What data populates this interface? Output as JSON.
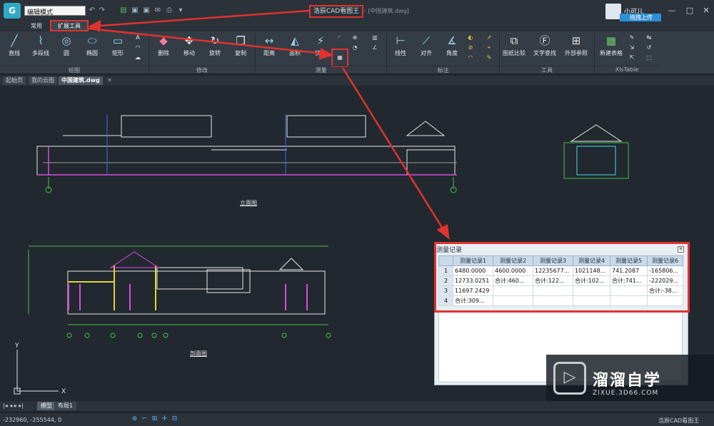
{
  "app": {
    "mode_select": "编辑模式",
    "title_main": "浩辰CAD看图王",
    "title_file": "- [中国建筑.dwg]",
    "user": "小可儿",
    "upload_btn": "拖拽上传",
    "accent_red": "#e0332e",
    "accent_blue": "#2e8fd8"
  },
  "ribbon_tabs": [
    "常用",
    "扩展工具"
  ],
  "ribbon": {
    "draw_items": [
      {
        "label": "直线",
        "icon": "line-icon"
      },
      {
        "label": "多段线",
        "icon": "polyline-icon"
      },
      {
        "label": "圆",
        "icon": "circle-icon"
      },
      {
        "label": "椭圆",
        "icon": "ellipse-icon"
      },
      {
        "label": "矩形",
        "icon": "rectangle-icon"
      }
    ],
    "edit_items": [
      {
        "label": "删除",
        "icon": "eraser-icon"
      },
      {
        "label": "移动",
        "icon": "move-icon"
      },
      {
        "label": "旋转",
        "icon": "rotate-icon"
      },
      {
        "label": "复制",
        "icon": "copy-icon"
      }
    ],
    "measure_items": [
      {
        "label": "距离",
        "icon": "distance-icon"
      },
      {
        "label": "面积",
        "icon": "area-icon"
      },
      {
        "label": "快速",
        "icon": "quick-measure-icon"
      }
    ],
    "annot_items": [
      {
        "label": "线性",
        "icon": "linear-dim-icon"
      },
      {
        "label": "对齐",
        "icon": "aligned-dim-icon"
      },
      {
        "label": "角度",
        "icon": "angle-dim-icon"
      }
    ],
    "tool_items": [
      {
        "label": "图纸比较",
        "icon": "compare-icon"
      },
      {
        "label": "文字查找",
        "icon": "text-find-icon"
      },
      {
        "label": "外部参照",
        "icon": "xref-icon"
      }
    ],
    "xls_items": [
      {
        "label": "新建表格",
        "icon": "new-table-icon"
      }
    ],
    "groups": [
      "绘图",
      "修改",
      "测量",
      "标注",
      "工具",
      "XlsTable"
    ]
  },
  "doc_tabs": [
    "起始页",
    "我的云图",
    "中国建筑.dwg"
  ],
  "drawing": {
    "label_elevation": "立面图",
    "label_section": "剖面图"
  },
  "measure_panel": {
    "title": "测量记录",
    "columns": [
      "测量记录1",
      "测量记录2",
      "测量记录3",
      "测量记录4",
      "测量记录5",
      "测量记录6"
    ],
    "rows": [
      [
        "1",
        "6480.0000",
        "4600.0000",
        "12235677...",
        "1021148...",
        "741.2087",
        "-165806..."
      ],
      [
        "2",
        "12733.0251",
        "合计:460...",
        "合计:122...",
        "合计:102...",
        "合计:741...",
        "-222029..."
      ],
      [
        "3",
        "11697.2429",
        "",
        "",
        "",
        "",
        "合计:-38..."
      ],
      [
        "4",
        "合计:309...",
        "",
        "",
        "",
        "",
        ""
      ]
    ]
  },
  "watermark": {
    "logo": "▷",
    "cn": "溜溜自学",
    "url": "ZIXUE.3D66.COM"
  },
  "layout_tabs": [
    "模型",
    "布局1"
  ],
  "status": {
    "coords": "-232960, -255544, 0",
    "app_name": "浩辰CAD看图王"
  }
}
